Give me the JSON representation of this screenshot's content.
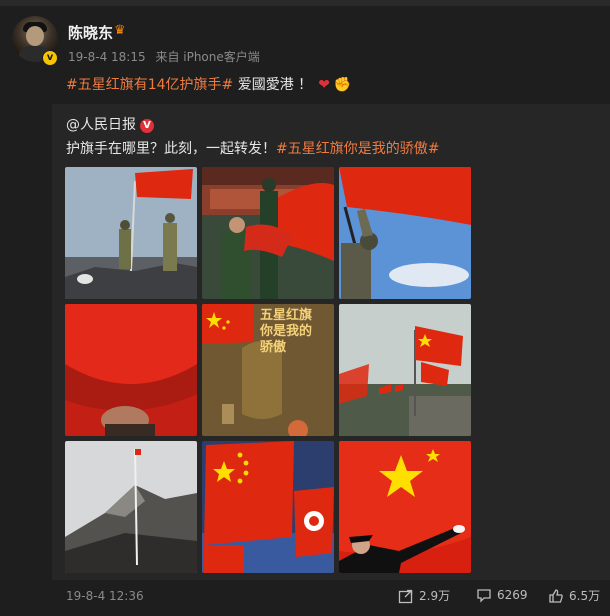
{
  "post": {
    "author": "陈晓东",
    "date": "19-8-4 18:15",
    "source": "来自 iPhone客户端",
    "tag": "#五星红旗有14亿护旗手#",
    "text": "爱國愛港 ！",
    "crown_icon": "crown-icon",
    "heart_icon": "heart-emoji",
    "fist_icon": "fist-emoji"
  },
  "repost": {
    "author": "@人民日报",
    "verified_icon": "red-v-verified-icon",
    "text": "护旗手在哪里？此刻，一起转发！",
    "tag": "#五星红旗你是我的骄傲#",
    "images": [
      "soldiers-guarding-flag-on-mountain",
      "honor-guard-raising-flag-forbidden-city",
      "soldier-holding-flag-against-sky",
      "hand-raising-red-flag",
      "five-star-red-flag-poster",
      "flags-on-great-wall",
      "flagpole-on-misty-mountain",
      "chinese-and-hk-flags",
      "honor-guard-throwing-flag"
    ],
    "poster_text": "五星红旗你是我的骄傲"
  },
  "footer": {
    "date": "19-8-4 12:36",
    "share_count": "2.9万",
    "comment_count": "6269",
    "like_count": "6.5万",
    "share_icon": "share-icon",
    "comment_icon": "comment-icon",
    "like_icon": "like-icon"
  },
  "colors": {
    "background": "#1e1e1e",
    "repost_bg": "#262626",
    "tag": "#f07b3f",
    "flag_red": "#de2910",
    "flag_yellow": "#ffde00"
  }
}
